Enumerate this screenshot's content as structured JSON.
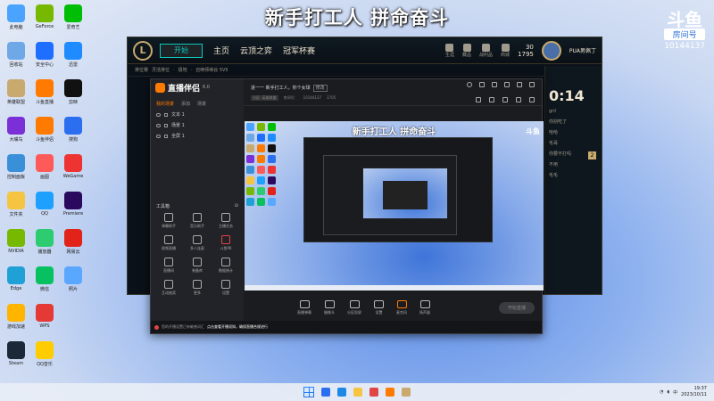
{
  "banner": "新手打工人 拼命奋斗",
  "watermark": {
    "logo": "斗鱼",
    "tag": "房间号",
    "room": "10144137"
  },
  "desktop_icons": [
    {
      "label": "此电脑",
      "color": "#4aa3ff"
    },
    {
      "label": "GeForce",
      "color": "#76b900"
    },
    {
      "label": "爱奇艺",
      "color": "#00be06"
    },
    {
      "label": "回收站",
      "color": "#6fa8e6"
    },
    {
      "label": "安全中心",
      "color": "#1e6fff"
    },
    {
      "label": "迅雷",
      "color": "#1e8cff"
    },
    {
      "label": "英雄联盟",
      "color": "#c8aa6e"
    },
    {
      "label": "斗鱼直播",
      "color": "#ff7a00"
    },
    {
      "label": "剪映",
      "color": "#111"
    },
    {
      "label": "大嘴鸟",
      "color": "#7b2fd6"
    },
    {
      "label": "斗鱼伴侣",
      "color": "#ff7a00"
    },
    {
      "label": "搜狗",
      "color": "#2b6ff0"
    },
    {
      "label": "控制面板",
      "color": "#3a8fd9"
    },
    {
      "label": "画图",
      "color": "#ff5a5a"
    },
    {
      "label": "WeGame",
      "color": "#e33"
    },
    {
      "label": "文件夹",
      "color": "#f5c542"
    },
    {
      "label": "QQ",
      "color": "#1ea0ff"
    },
    {
      "label": "Premiere",
      "color": "#2a0a5e"
    },
    {
      "label": "NVIDIA",
      "color": "#76b900"
    },
    {
      "label": "播放器",
      "color": "#2ecc71"
    },
    {
      "label": "网易云",
      "color": "#e2231a"
    },
    {
      "label": "Edge",
      "color": "#1fa1d8"
    },
    {
      "label": "微信",
      "color": "#07c160"
    },
    {
      "label": "照片",
      "color": "#5aa7ff"
    },
    {
      "label": "游戏加速",
      "color": "#ffb400"
    },
    {
      "label": "WPS",
      "color": "#e53935"
    },
    {
      "label": "",
      "color": "transparent"
    },
    {
      "label": "Steam",
      "color": "#1b2838"
    },
    {
      "label": "QQ音乐",
      "color": "#ffcc00"
    }
  ],
  "lol": {
    "logo": "L",
    "play": "开始",
    "tabs": [
      "主页",
      "云顶之弈",
      "冠军杯赛"
    ],
    "right_items": [
      "生涯",
      "藏品",
      "战利品",
      "商城"
    ],
    "currency": [
      "30",
      "1795"
    ],
    "player_name": "PUA男佩丁",
    "sub_nav": [
      "排位赛",
      "灵活排位",
      "·",
      "极地",
      "·",
      "召唤师峡谷 5V5"
    ],
    "timer": "0:14",
    "chat": [
      "gril",
      "你别吃了",
      "哈哈",
      "毛哥",
      "你要不打吗",
      "不用",
      "毛毛"
    ],
    "badge": "2"
  },
  "douyu": {
    "logo_title": "直播伴侣",
    "version": "6.0",
    "tabs": [
      "我的场景",
      "添加",
      "场景"
    ],
    "scenes": [
      "文本 1",
      "场景 1",
      "全屏 1"
    ],
    "tools_title": "工具箱",
    "tools": [
      "弹幕助手",
      "音乐助手",
      "主播任务",
      "视频直播",
      "多人连麦",
      "斗鱼PK",
      "直播间",
      "装备库",
      "数据统计",
      "互动抽奖",
      "更多",
      "设置"
    ],
    "title_text": "进一一 新手打工人，你个女球",
    "edit_label": "修改",
    "meta": [
      "分区: 英雄联盟",
      "房间号：",
      "10144137",
      "1705"
    ],
    "bottom_tools": [
      "直播弹幕",
      "摄像头",
      "分区投屏",
      "设置",
      "麦克风",
      "扬声器"
    ],
    "start_button": "开始直播",
    "status_warning": "您的开播设置已有敏感词汇",
    "status_link": "点击查看开播须知，确保直播合规进行"
  },
  "preview": {
    "banner": "新手打工人 拼命奋斗",
    "wm": "斗鱼"
  },
  "taskbar_apps": [
    "#2a6ff0",
    "#1e88e5",
    "#f5c542",
    "#e04545",
    "#ff7a00",
    "#c8aa6e"
  ],
  "tray": {
    "lang": "中",
    "time": "19:37",
    "date": "2023/10/11"
  }
}
